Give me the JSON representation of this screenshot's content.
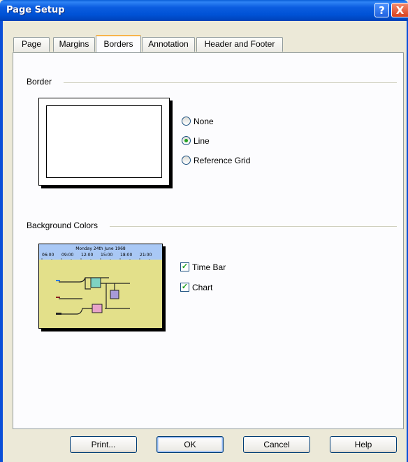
{
  "window": {
    "title": "Page Setup"
  },
  "title_buttons": {
    "help": "?",
    "close": "X"
  },
  "tabs": [
    {
      "label": "Page",
      "active": false
    },
    {
      "label": "Margins",
      "active": false
    },
    {
      "label": "Borders",
      "active": true
    },
    {
      "label": "Annotation",
      "active": false
    },
    {
      "label": "Header and Footer",
      "active": false
    }
  ],
  "border_group": {
    "label": "Border",
    "options": [
      {
        "label": "None",
        "selected": false
      },
      {
        "label": "Line",
        "selected": true
      },
      {
        "label": "Reference Grid",
        "selected": false
      }
    ]
  },
  "background_group": {
    "label": "Background Colors",
    "preview": {
      "date_text": "Monday 24th June 1968",
      "times": [
        "06:00",
        "09:00",
        "12:00",
        "15:00",
        "18:00",
        "21:00"
      ],
      "time_bar_color": "#a9c8f5",
      "chart_color": "#e3e08a"
    },
    "options": [
      {
        "label": "Time Bar",
        "checked": true
      },
      {
        "label": "Chart",
        "checked": true
      }
    ]
  },
  "buttons": {
    "print": "Print...",
    "ok": "OK",
    "cancel": "Cancel",
    "help": "Help"
  }
}
